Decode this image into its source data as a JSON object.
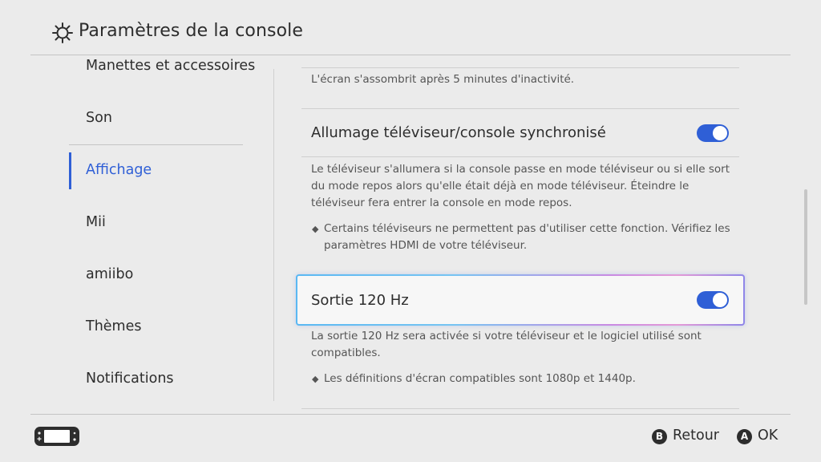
{
  "header": {
    "icon": "gear-icon",
    "title": "Paramètres de la console"
  },
  "sidebar": {
    "items": [
      {
        "label": "Manettes et accessoires"
      },
      {
        "label": "Son"
      },
      {
        "label": "Affichage",
        "active": true
      },
      {
        "label": "Mii"
      },
      {
        "label": "amiibo"
      },
      {
        "label": "Thèmes"
      },
      {
        "label": "Notifications"
      }
    ]
  },
  "content": {
    "top_desc": "L'écran s'assombrit après 5 minutes d'inactivité.",
    "settings": [
      {
        "label": "Allumage téléviseur/console synchronisé",
        "enabled": true,
        "desc_lines": [
          "Le téléviseur s'allumera si la console passe en mode téléviseur ou si elle sort",
          "du mode repos alors qu'elle était déjà en mode téléviseur. Éteindre le",
          "téléviseur fera entrer la console en mode repos."
        ],
        "note_lines": [
          "Certains téléviseurs ne permettent pas d'utiliser cette fonction. Vérifiez les",
          "paramètres HDMI de votre téléviseur."
        ]
      },
      {
        "label": "Sortie 120 Hz",
        "enabled": true,
        "selected": true,
        "desc_lines": [
          "La sortie 120 Hz sera activée si votre téléviseur et le logiciel utilisé sont",
          "compatibles."
        ],
        "note_lines": [
          "Les définitions d'écran compatibles sont 1080p et 1440p."
        ]
      }
    ],
    "bullet_glyph": "◆"
  },
  "footer": {
    "console_icon": "console-handheld-icon",
    "back": {
      "button": "B",
      "label": "Retour"
    },
    "ok": {
      "button": "A",
      "label": "OK"
    }
  },
  "colors": {
    "accent": "#2f5fd6",
    "background": "#ebebeb"
  }
}
